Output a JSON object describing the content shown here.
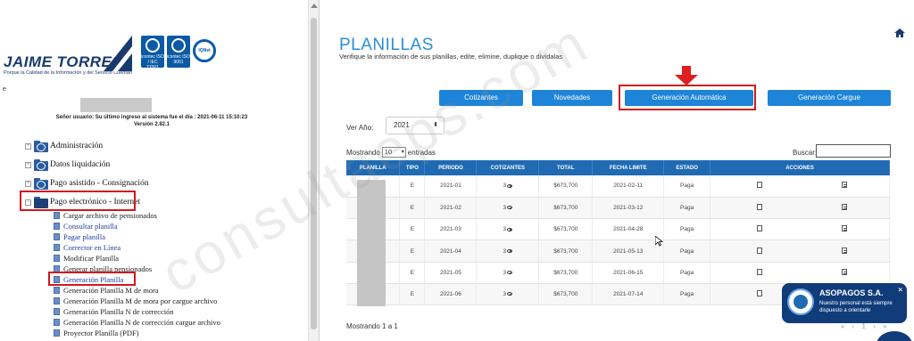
{
  "left": {
    "logo_text": "JAIME TORRES",
    "logo_sub": "Porque la Calidad de la Información y del Servicio Cuentan",
    "certs": [
      "icontec ISO / IEC 27001",
      "icontec ISO 9001",
      "IQNet"
    ],
    "small_marker": "e",
    "user_info_line1": "Señor usuario: Su último ingreso al sistema fue el día : 2021-06-11 15:10:23",
    "user_info_line2": "Versión 2.82.1",
    "tree_top": [
      {
        "label": "Administración"
      },
      {
        "label": "Datos liquidación"
      },
      {
        "label": "Pago asistido - Consignación"
      },
      {
        "label": "Pago electrónico - Internet"
      }
    ],
    "sub_items": [
      {
        "label": "Cargar archivo de pensionados",
        "link": false
      },
      {
        "label": "Consultar planilla",
        "link": true
      },
      {
        "label": "Pagar planilla",
        "link": true
      },
      {
        "label": "Corrector en Línea",
        "link": true
      },
      {
        "label": "Modificar Planilla",
        "link": false
      },
      {
        "label": "Generar planilla pensionados",
        "link": false
      },
      {
        "label": "Generación Planilla",
        "link": true
      },
      {
        "label": "Generación Planilla M de mora",
        "link": false
      },
      {
        "label": "Generación Planilla M de mora por cargue archivo",
        "link": false
      },
      {
        "label": "Generación Planilla N de corrección",
        "link": false
      },
      {
        "label": "Generación Planilla N de corrección cargue archivo",
        "link": false
      },
      {
        "label": "Proyector Planilla (PDF)",
        "link": false
      }
    ]
  },
  "right": {
    "title": "PLANILLAS",
    "subtitle": "Verifique la información de sus planillas, edite, elimine, duplique o divídalas",
    "buttons": {
      "cotizantes": "Cotizantes",
      "novedades": "Novedades",
      "generacion_automatica": "Generación Automática",
      "generacion_cargue": "Generación Cargue"
    },
    "year_label": "Ver Año:",
    "year_value": "2021",
    "showing_prefix": "Mostrando",
    "entries_value": "10",
    "showing_suffix": "entradas",
    "search_label": "Buscar:",
    "columns": [
      "PLANILLA",
      "TIPO",
      "PERIODO",
      "COTIZANTES",
      "TOTAL",
      "FECHA LIMITE",
      "ESTADO",
      "ACCIONES"
    ],
    "rows": [
      {
        "tipo": "E",
        "periodo": "2021-01",
        "cotizantes": "3",
        "total": "$673,700",
        "fecha": "2021-02-11",
        "estado": "Paga"
      },
      {
        "tipo": "E",
        "periodo": "2021-02",
        "cotizantes": "3",
        "total": "$673,700",
        "fecha": "2021-03-12",
        "estado": "Paga"
      },
      {
        "tipo": "E",
        "periodo": "2021-03",
        "cotizantes": "3",
        "total": "$673,700",
        "fecha": "2021-04-28",
        "estado": "Paga"
      },
      {
        "tipo": "E",
        "periodo": "2021-04",
        "cotizantes": "3",
        "total": "$673,700",
        "fecha": "2021-05-13",
        "estado": "Paga"
      },
      {
        "tipo": "E",
        "periodo": "2021-05",
        "cotizantes": "3",
        "total": "$673,700",
        "fecha": "2021-06-15",
        "estado": "Paga"
      },
      {
        "tipo": "E",
        "periodo": "2021-06",
        "cotizantes": "3",
        "total": "$673,700",
        "fecha": "2021-07-14",
        "estado": "Paga"
      }
    ],
    "footer_showing": "Mostrando 1 a 1",
    "pager": "« ‹ 1 › »"
  },
  "chat": {
    "title": "ASOPAGOS S.A.",
    "text": "Nuestro personal está siempre dispuesto a orientarle",
    "close": "×"
  },
  "watermark": "consultaeps.com",
  "colors": {
    "accent_blue": "#1e84d8",
    "header_blue": "#1f6ab3",
    "highlight_red": "#d0191f",
    "chat_navy": "#103c7a"
  }
}
